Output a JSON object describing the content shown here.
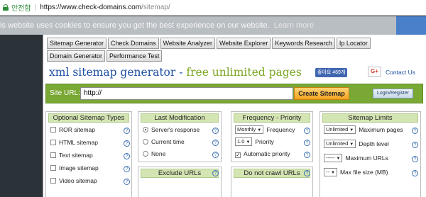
{
  "browser": {
    "secure_label": "안전함",
    "url_host": "https://www.check-domains.com",
    "url_path": "/sitemap/"
  },
  "cookie_banner": {
    "message": "is website uses cookies to ensure you get the best experience on our website.",
    "learn_more": "Learn more"
  },
  "nav": {
    "items": [
      "Sitemap Generator",
      "Check Domains",
      "Website Analyzer",
      "Website Explorer",
      "Keywords Research",
      "Ip Locator",
      "Domain Generator",
      "Performance Test"
    ]
  },
  "header": {
    "title_part1": "xml sitemap generator",
    "title_dash": " - ",
    "title_part2": "free unlimited pages",
    "fb_like": "좋아요 469개",
    "gplus": "G+",
    "contact": "Contact Us"
  },
  "site_url": {
    "label": "Site URL:",
    "value": "http://",
    "create_button": "Create Sitemap",
    "login_button": "Login/Register"
  },
  "panels": {
    "optional_types": {
      "title": "Optional Sitemap Types",
      "items": [
        "ROR sitemap",
        "HTML sitemap",
        "Text sitemap",
        "Image sitemap",
        "Video sitemap"
      ]
    },
    "last_modification": {
      "title": "Last Modification",
      "options": [
        "Server's response",
        "Current time",
        "None"
      ],
      "selected": "Server's response"
    },
    "frequency_priority": {
      "title": "Frequency - Priority",
      "frequency_value": "Monthly",
      "frequency_label": "Frequency",
      "priority_value": "1.0",
      "priority_label": "Priority",
      "automatic_label": "Automatic priority",
      "automatic_checked": true
    },
    "sitemap_limits": {
      "title": "Sitemap Limits",
      "max_pages_value": "Unlimited",
      "max_pages_label": "Maximum pages",
      "depth_value": "Unlimited",
      "depth_label": "Depth level",
      "max_urls_value": "-----",
      "max_urls_label": "Maximum URLs",
      "max_file_value": "--",
      "max_file_label": "Max file size (MB)"
    },
    "exclude_urls": {
      "title": "Exclude URLs"
    },
    "do_not_crawl": {
      "title": "Do not crawl URLs"
    }
  },
  "colors": {
    "brand_blue": "#1f4fa3",
    "brand_green": "#7ba621",
    "site_bar": "#79a834",
    "create_button": "#f2a41f"
  }
}
